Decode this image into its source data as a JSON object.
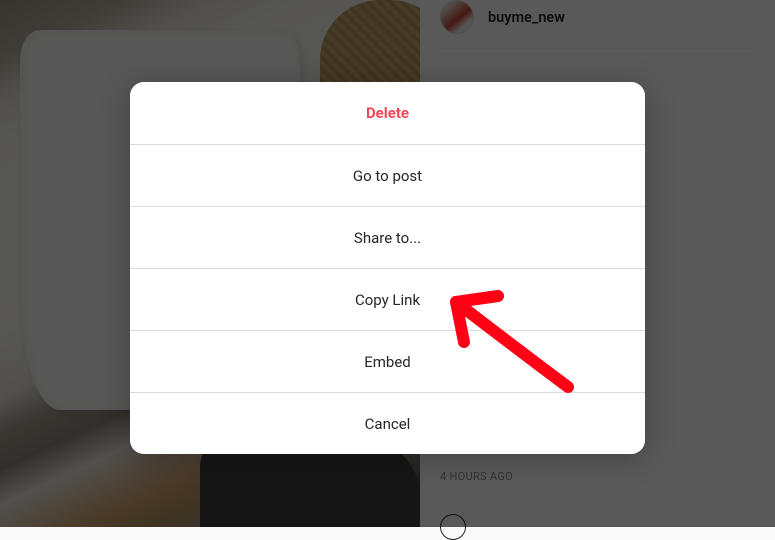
{
  "post": {
    "username": "buyme_new",
    "timestamp": "4 HOURS AGO"
  },
  "modal": {
    "options": {
      "delete": "Delete",
      "goto": "Go to post",
      "share": "Share to...",
      "copy": "Copy Link",
      "embed": "Embed",
      "cancel": "Cancel"
    }
  },
  "annotation": {
    "target": "copy-link-option"
  }
}
